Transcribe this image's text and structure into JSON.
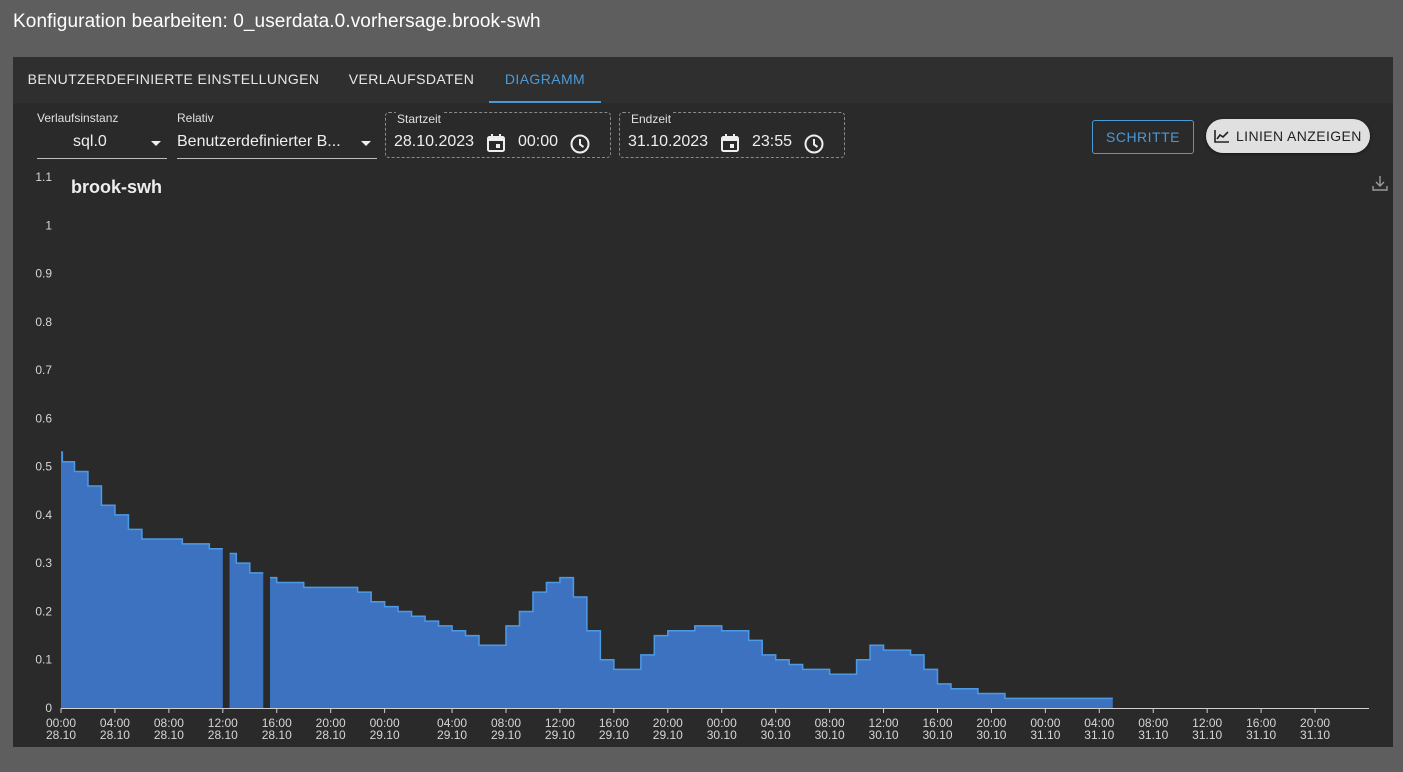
{
  "dialog": {
    "title": "Konfiguration bearbeiten: 0_userdata.0.vorhersage.brook-swh"
  },
  "tabs": [
    {
      "label": "BENUTZERDEFINIERTE EINSTELLUNGEN"
    },
    {
      "label": "VERLAUFSDATEN"
    },
    {
      "label": "DIAGRAMM",
      "active": true
    }
  ],
  "controls": {
    "instance": {
      "label": "Verlaufsinstanz",
      "value": "sql.0"
    },
    "relative": {
      "label": "Relativ",
      "value": "Benutzerdefinierter B..."
    },
    "start": {
      "label": "Startzeit",
      "date": "28.10.2023",
      "time": "00:00"
    },
    "end": {
      "label": "Endzeit",
      "date": "31.10.2023",
      "time": "23:55"
    },
    "steps_button": "SCHRITTE",
    "lines_button": "LINIEN ANZEIGEN"
  },
  "icons": {
    "calendar": "calendar-icon",
    "clock": "clock-icon",
    "chart": "line-chart-icon",
    "download": "download-icon"
  },
  "colors": {
    "accent": "#4a9ad8",
    "series_fill": "#3d72c0",
    "series_line": "#4c9ae6"
  },
  "chart_data": {
    "type": "area",
    "title": "brook-swh",
    "step": true,
    "ylim": [
      0,
      1.1
    ],
    "yticks": [
      "0",
      "0.1",
      "0.2",
      "0.3",
      "0.4",
      "0.5",
      "0.6",
      "0.7",
      "0.8",
      "0.9",
      "1",
      "1.1"
    ],
    "xlim_hours": [
      0,
      97
    ],
    "xticks": [
      {
        "h": 0,
        "time": "00:00",
        "date": "28.10"
      },
      {
        "h": 4,
        "time": "04:00",
        "date": "28.10"
      },
      {
        "h": 8,
        "time": "08:00",
        "date": "28.10"
      },
      {
        "h": 12,
        "time": "12:00",
        "date": "28.10"
      },
      {
        "h": 16,
        "time": "16:00",
        "date": "28.10"
      },
      {
        "h": 20,
        "time": "20:00",
        "date": "28.10"
      },
      {
        "h": 24,
        "time": "00:00",
        "date": "29.10"
      },
      {
        "h": 29,
        "time": "04:00",
        "date": "29.10"
      },
      {
        "h": 33,
        "time": "08:00",
        "date": "29.10"
      },
      {
        "h": 37,
        "time": "12:00",
        "date": "29.10"
      },
      {
        "h": 41,
        "time": "16:00",
        "date": "29.10"
      },
      {
        "h": 45,
        "time": "20:00",
        "date": "29.10"
      },
      {
        "h": 49,
        "time": "00:00",
        "date": "30.10"
      },
      {
        "h": 53,
        "time": "04:00",
        "date": "30.10"
      },
      {
        "h": 57,
        "time": "08:00",
        "date": "30.10"
      },
      {
        "h": 61,
        "time": "12:00",
        "date": "30.10"
      },
      {
        "h": 65,
        "time": "16:00",
        "date": "30.10"
      },
      {
        "h": 69,
        "time": "20:00",
        "date": "30.10"
      },
      {
        "h": 73,
        "time": "00:00",
        "date": "31.10"
      },
      {
        "h": 77,
        "time": "04:00",
        "date": "31.10"
      },
      {
        "h": 81,
        "time": "08:00",
        "date": "31.10"
      },
      {
        "h": 85,
        "time": "12:00",
        "date": "31.10"
      },
      {
        "h": 89,
        "time": "16:00",
        "date": "31.10"
      },
      {
        "h": 93,
        "time": "20:00",
        "date": "31.10"
      }
    ],
    "segments": [
      {
        "points": [
          [
            0,
            0.53
          ],
          [
            0.1,
            0.51
          ],
          [
            1,
            0.49
          ],
          [
            2,
            0.46
          ],
          [
            3,
            0.42
          ],
          [
            4,
            0.4
          ],
          [
            5,
            0.37
          ],
          [
            6,
            0.35
          ],
          [
            9,
            0.34
          ],
          [
            11,
            0.33
          ],
          [
            12,
            0.33
          ]
        ]
      },
      {
        "points": [
          [
            12.5,
            0.32
          ],
          [
            13,
            0.3
          ],
          [
            14,
            0.28
          ],
          [
            15,
            0.28
          ]
        ]
      },
      {
        "points": [
          [
            15.5,
            0.27
          ],
          [
            16,
            0.26
          ],
          [
            18,
            0.25
          ],
          [
            22,
            0.24
          ],
          [
            23,
            0.22
          ],
          [
            24,
            0.21
          ],
          [
            25,
            0.2
          ],
          [
            26,
            0.19
          ],
          [
            27,
            0.18
          ],
          [
            28,
            0.17
          ],
          [
            29,
            0.16
          ],
          [
            30,
            0.15
          ],
          [
            31,
            0.13
          ],
          [
            33,
            0.17
          ],
          [
            34,
            0.2
          ],
          [
            35,
            0.24
          ],
          [
            36,
            0.26
          ],
          [
            37,
            0.27
          ],
          [
            38,
            0.23
          ],
          [
            39,
            0.16
          ],
          [
            40,
            0.1
          ],
          [
            41,
            0.08
          ],
          [
            43,
            0.11
          ],
          [
            44,
            0.15
          ],
          [
            45,
            0.16
          ],
          [
            47,
            0.17
          ],
          [
            49,
            0.16
          ],
          [
            51,
            0.14
          ],
          [
            52,
            0.11
          ],
          [
            53,
            0.1
          ],
          [
            54,
            0.09
          ],
          [
            55,
            0.08
          ],
          [
            57,
            0.07
          ],
          [
            59,
            0.1
          ],
          [
            60,
            0.13
          ],
          [
            61,
            0.12
          ],
          [
            63,
            0.11
          ],
          [
            64,
            0.08
          ],
          [
            65,
            0.05
          ],
          [
            66,
            0.04
          ],
          [
            68,
            0.03
          ],
          [
            70,
            0.02
          ],
          [
            78,
            0.02
          ]
        ]
      }
    ]
  }
}
